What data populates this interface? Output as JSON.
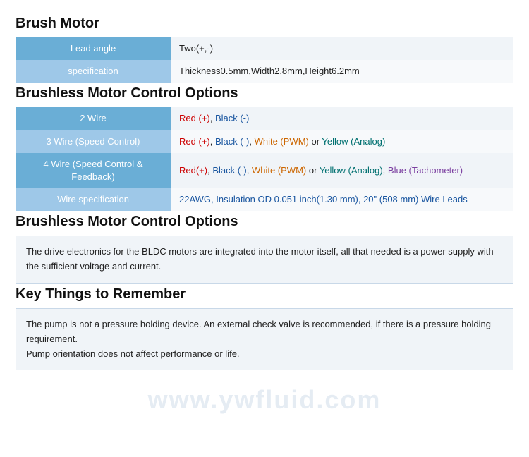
{
  "sections": [
    {
      "id": "brush-motor",
      "title": "Brush Motor",
      "type": "table",
      "rows": [
        {
          "label": "Lead angle",
          "value_plain": "Two(+,-)",
          "value_parts": [
            {
              "text": "Two(+,-)",
              "color": "normal"
            }
          ]
        },
        {
          "label": "specification",
          "value_plain": "Thickness0.5mm,Width2.8mm,Height6.2mm",
          "value_parts": [
            {
              "text": "Thickness0.5mm,Width2.8mm,Height6.2mm",
              "color": "normal"
            }
          ]
        }
      ]
    },
    {
      "id": "brushless-motor-control",
      "title": "Brushless Motor Control Options",
      "type": "table",
      "rows": [
        {
          "label": "2 Wire",
          "value_html": "<span class='text-red'>Red (+)</span>, <span class='text-blue'>Black (-)</span>"
        },
        {
          "label": "3 Wire (Speed Control)",
          "value_html": "<span class='text-red'>Red (+)</span>, <span class='text-blue'>Black (-)</span>, <span class='text-orange'>White (PWM)</span> or <span class='text-teal'>Yellow (Analog)</span>"
        },
        {
          "label": "4 Wire (Speed Control & Feedback)",
          "value_html": "<span class='text-red'>Red(+)</span>, <span class='text-blue'>Black (-)</span>, <span class='text-orange'>White (PWM)</span> or <span class='text-teal'>Yellow (Analog)</span>, <span class='text-purple'>Blue (Tachometer)</span>"
        },
        {
          "label": "Wire specification",
          "value_html": "<span class='wire-spec-value'>22AWG, Insulation OD 0.051 inch(1.30 mm), 20\" (508 mm) Wire Leads</span>"
        }
      ]
    },
    {
      "id": "brushless-motor-desc",
      "title": "Brushless Motor Control Options",
      "type": "infobox",
      "text": "The drive electronics for the BLDC motors are integrated into the motor itself, all that needed is a power supply with the sufficient voltage and current."
    },
    {
      "id": "key-things",
      "title": "Key Things to Remember",
      "type": "infobox",
      "lines": [
        "The pump is not a pressure holding device. An external check valve is recommended, if there is a pressure holding requirement.",
        "Pump orientation does not affect performance or life."
      ]
    }
  ],
  "watermark": "www.ywfluid.com"
}
